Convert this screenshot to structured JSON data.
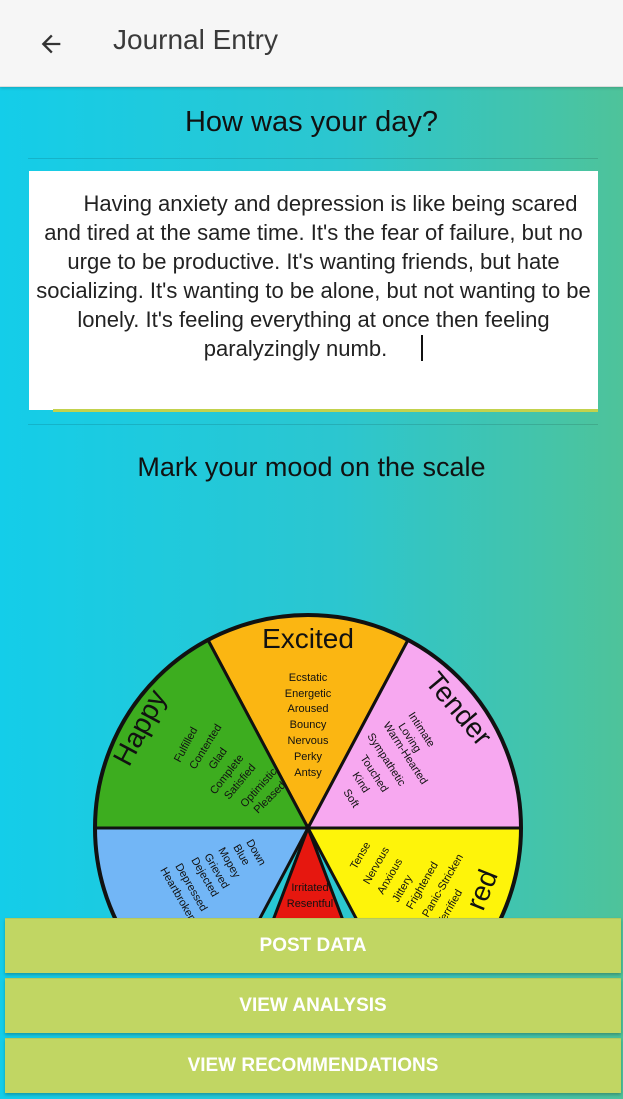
{
  "appbar": {
    "back_icon": "arrow-back-icon",
    "title": "Journal Entry"
  },
  "journal": {
    "question": "How was your day?",
    "entry_text": "Having anxiety and depression is like being scared and tired at the same time. It's the fear of failure, but no urge to be productive. It's wanting friends, but hate socializing. It's wanting to be alone, but not wanting to be lonely. It's feeling everything at once then feeling paralyzingly numb."
  },
  "mood": {
    "prompt": "Mark your mood on the scale",
    "wheel": {
      "excited": {
        "title": "Excited",
        "words": [
          "Ecstatic",
          "Energetic",
          "Aroused",
          "Bouncy",
          "Nervous",
          "Perky",
          "Antsy"
        ],
        "color": "#fbb612"
      },
      "happy": {
        "title": "Happy",
        "words": [
          "Fulfilled",
          "Contented",
          "Glad",
          "Complete",
          "Satisfied",
          "Optimistic",
          "Pleased"
        ],
        "color": "#3dad1f"
      },
      "tender": {
        "title": "Tender",
        "words": [
          "Intimate",
          "Loving",
          "Warm-Hearted",
          "Sympathetic",
          "Touched",
          "Kind",
          "Soft"
        ],
        "color": "#f7a8f0"
      },
      "sad": {
        "words": [
          "Down",
          "Blue",
          "Mopey",
          "Grieved",
          "Dejected",
          "Depressed",
          "Heartbroken"
        ],
        "color": "#72b6f6"
      },
      "angry": {
        "words": [
          "Irritated",
          "Resentful"
        ],
        "color": "#e6170f"
      },
      "scared": {
        "title_fragment": "red",
        "words": [
          "Tense",
          "Nervous",
          "Anxious",
          "Jittery",
          "Frightened",
          "Panic-Stricken",
          "Terrified"
        ],
        "color": "#fef40a"
      }
    }
  },
  "actions": {
    "post": "POST DATA",
    "analysis": "VIEW ANALYSIS",
    "recommendations": "VIEW RECOMMENDATIONS"
  },
  "colors": {
    "accent_button": "#c1d663",
    "gradient_left": "#14cde9",
    "gradient_right": "#4ec39a"
  }
}
